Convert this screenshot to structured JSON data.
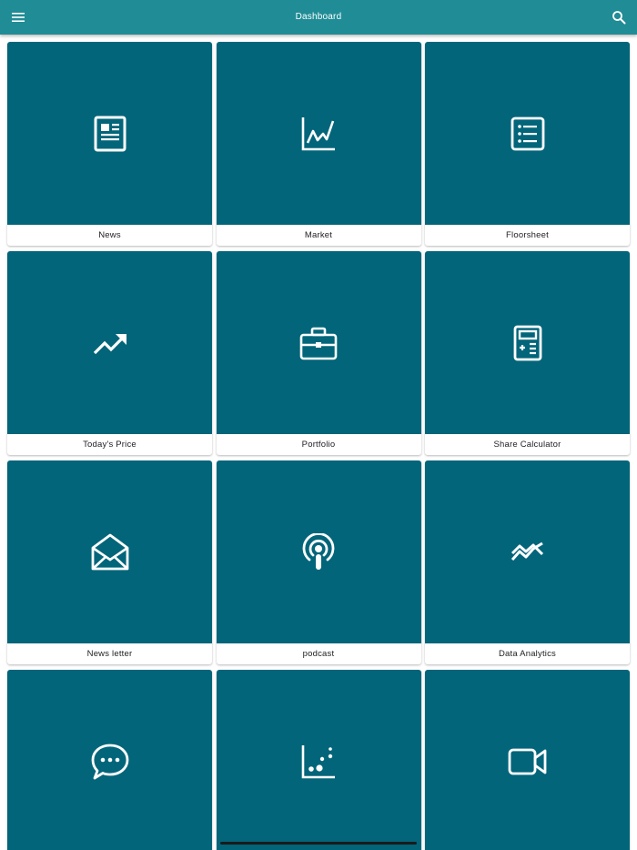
{
  "appbar": {
    "title": "Dashboard",
    "menu_icon": "hamburger-menu-icon",
    "search_icon": "search-icon",
    "color": "#208c96"
  },
  "tile_color": "#02657a",
  "cards": [
    {
      "label": "News",
      "icon": "newspaper-icon"
    },
    {
      "label": "Market",
      "icon": "line-chart-icon"
    },
    {
      "label": "Floorsheet",
      "icon": "list-icon"
    },
    {
      "label": "Today's Price",
      "icon": "trending-up-icon"
    },
    {
      "label": "Portfolio",
      "icon": "briefcase-icon"
    },
    {
      "label": "Share Calculator",
      "icon": "calculator-icon"
    },
    {
      "label": "News letter",
      "icon": "open-envelope-icon"
    },
    {
      "label": "podcast",
      "icon": "podcast-icon"
    },
    {
      "label": "Data Analytics",
      "icon": "analytics-icon"
    },
    {
      "label": "",
      "icon": "chat-bubble-icon"
    },
    {
      "label": "",
      "icon": "scatter-plot-icon"
    },
    {
      "label": "",
      "icon": "video-camera-icon"
    }
  ]
}
